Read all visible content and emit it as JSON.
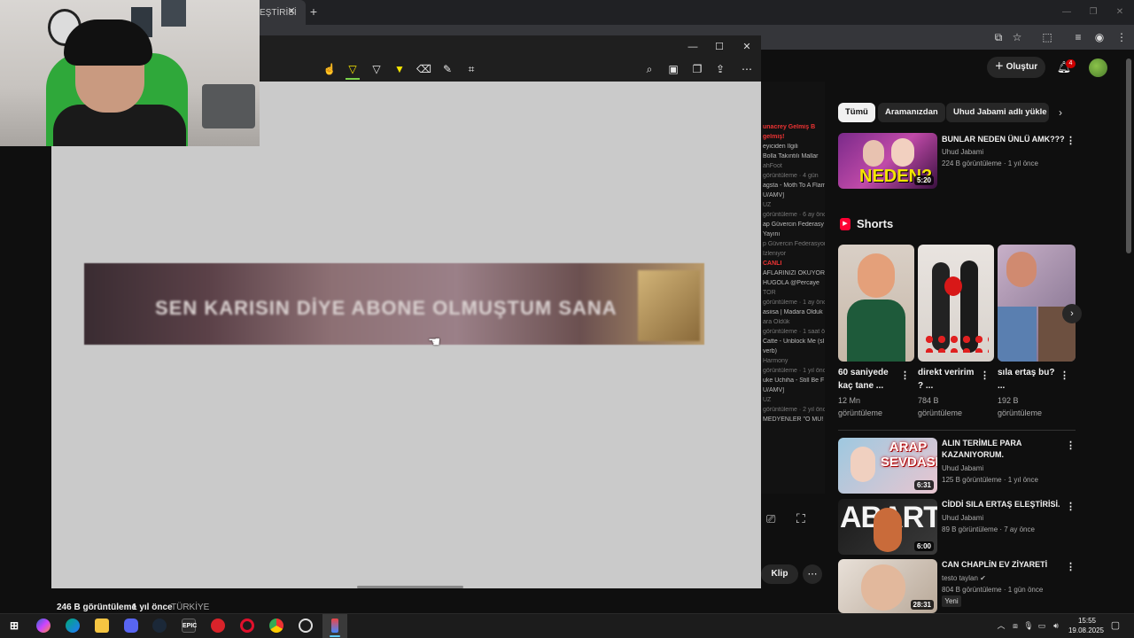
{
  "browser": {
    "tab_title": "EŞTİRİSİ",
    "tab_close": "✕",
    "new_tab": "+",
    "window_controls": [
      "—",
      "❐",
      "✕"
    ],
    "toolbar_icons": [
      "cast-icon",
      "star-icon",
      "extensions-icon",
      "media-icon",
      "profile-icon",
      "menu-icon"
    ]
  },
  "viewer": {
    "window_controls": [
      "—",
      "☐",
      "✕"
    ],
    "tools": [
      "touch-write-icon",
      "pen-icon",
      "pen-icon",
      "highlighter-icon",
      "eraser-icon",
      "ruler-icon",
      "crop-icon"
    ],
    "right_tools": [
      "zoom-icon",
      "save-icon",
      "copy-icon",
      "share-icon",
      "more-icon"
    ],
    "image_text": "SEN KARISIN DİYE ABONE OLMUŞTUM SANA"
  },
  "video_info": {
    "views": "246 B görüntüleme",
    "age": "1 yıl önce",
    "country": "TÜRKİYE"
  },
  "bg_strip": {
    "lines": [
      {
        "t": "unacrey Gelmiş B",
        "c": "red"
      },
      {
        "t": "gelmiş!",
        "c": "red"
      },
      {
        "t": "eyiciden   İlgili",
        "c": ""
      },
      {
        "t": "Bolla Takıntılı Mallar",
        "c": ""
      },
      {
        "t": "ahFoot",
        "c": "dim"
      },
      {
        "t": "görüntüleme · 4 gün",
        "c": "dim"
      },
      {
        "t": "agsta - Moth To A Flam",
        "c": ""
      },
      {
        "t": "U/AMV]",
        "c": ""
      },
      {
        "t": "UZ",
        "c": "dim"
      },
      {
        "t": "görüntüleme · 6 ay önc",
        "c": "dim"
      },
      {
        "t": "ap Güvercin Federasy",
        "c": ""
      },
      {
        "t": "Yayını",
        "c": ""
      },
      {
        "t": "p Güvercin Federasyonu",
        "c": "dim"
      },
      {
        "t": "İzleniyor",
        "c": "dim"
      },
      {
        "t": "CANLI",
        "c": "red"
      },
      {
        "t": "AFLARINIZI OKUYOR",
        "c": ""
      },
      {
        "t": "HUGOLA @Percaye",
        "c": ""
      },
      {
        "t": "TOR",
        "c": "dim"
      },
      {
        "t": "görüntüleme · 1 ay önce",
        "c": "dim"
      },
      {
        "t": "asiisa | Madara Olduk",
        "c": ""
      },
      {
        "t": "ara Oldük",
        "c": "dim"
      },
      {
        "t": "görüntüleme · 1 saat ön",
        "c": "dim"
      },
      {
        "t": "Catte - Unblock Me (sl",
        "c": ""
      },
      {
        "t": "verb)",
        "c": ""
      },
      {
        "t": "Harmony",
        "c": "dim"
      },
      {
        "t": "görüntüleme · 1 yıl önce",
        "c": "dim"
      },
      {
        "t": "uke Uchiha - Still Be F",
        "c": ""
      },
      {
        "t": "U/AMV]",
        "c": ""
      },
      {
        "t": "UZ",
        "c": "dim"
      },
      {
        "t": "görüntüleme · 2 yıl önc",
        "c": "dim"
      },
      {
        "t": "MEDYENLER \"O MU! S",
        "c": ""
      }
    ],
    "klip": "Klip",
    "more": "⋯"
  },
  "youtube": {
    "create_label": "Oluştur",
    "notif_count": "4",
    "chips": [
      "Tümü",
      "Aramanızdan",
      "Uhud Jabami adlı yükle"
    ],
    "video1": {
      "title": "BUNLAR NEDEN ÜNLÜ AMK???",
      "channel": "Uhud Jabami",
      "meta": "224 B görüntüleme · 1 yıl önce",
      "duration": "5:20",
      "thumb_text": "NEDEN?"
    },
    "shorts_title": "Shorts",
    "shorts": [
      {
        "title": "60 saniyede kaç tane ...",
        "views": "12 Mn görüntüleme"
      },
      {
        "title": "direkt veririm ? ...",
        "views": "784 B görüntüleme"
      },
      {
        "title": "sıla ertaş bu? ...",
        "views": "192 B görüntüleme"
      }
    ],
    "videos": [
      {
        "title": "ALIN TERİMLE PARA KAZANIYORUM.",
        "channel": "Uhud Jabami",
        "meta": "125 B görüntüleme · 1 yıl önce",
        "duration": "6:31",
        "thumb_text": "ARAP SEVDASI"
      },
      {
        "title": "CİDDİ SILA ERTAŞ ELEŞTİRİSİ.",
        "channel": "Uhud Jabami",
        "meta": "89 B görüntüleme · 7 ay önce",
        "duration": "6:00",
        "thumb_text": "ABARTI"
      },
      {
        "title": "CAN CHAPLİN EV ZİYARETİ",
        "channel": "testo taylan ✔",
        "meta": "804 B görüntüleme · 1 gün önce",
        "duration": "28:31",
        "badge": "Yeni"
      }
    ]
  },
  "taskbar": {
    "apps": [
      "windows-start",
      "copilot",
      "edge",
      "file-explorer",
      "discord",
      "steam",
      "epic-games",
      "app-red",
      "opera",
      "chrome",
      "app-speed",
      "active-app"
    ],
    "epic_label": "EPIC",
    "time": "15:55",
    "date": "19.08.2025"
  }
}
